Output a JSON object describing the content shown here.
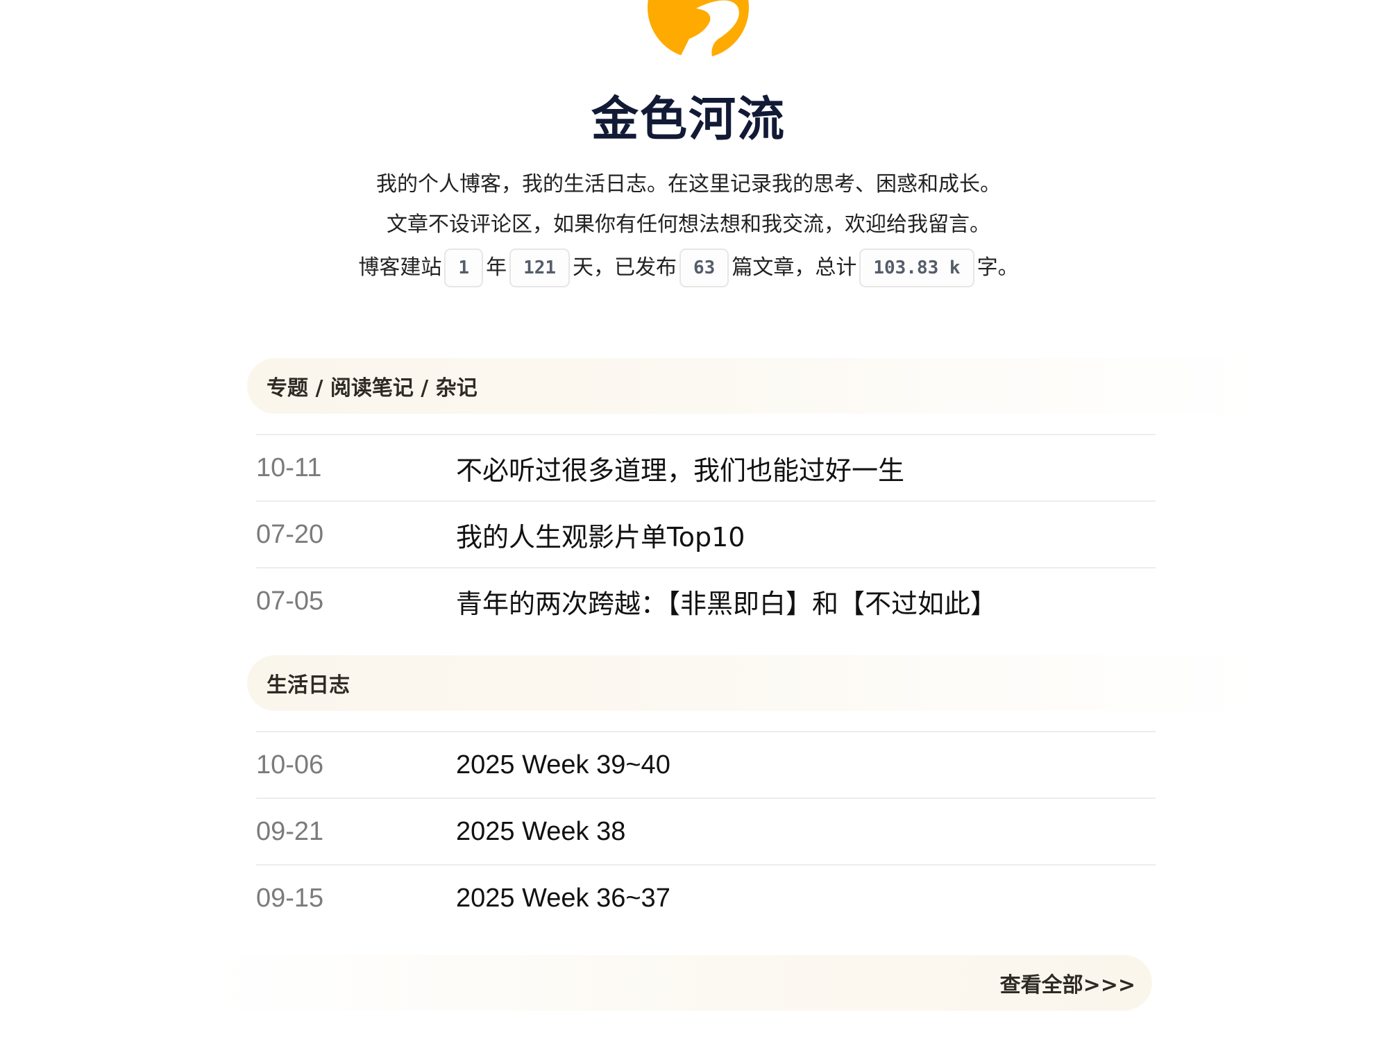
{
  "header": {
    "logo_icon": "golden-river-logo-icon",
    "logo_color": "#ffaa00",
    "site_title": "金色河流",
    "intro_line1": "我的个人博客，我的生活日志。在这里记录我的思考、困惑和成长。",
    "intro_line2": "文章不设评论区，如果你有任何想法想和我交流，欢迎给我留言。",
    "stats": {
      "prefix": "博客建站",
      "years": "1",
      "years_unit": "年",
      "days": "121",
      "days_unit": "天，已发布",
      "posts": "63",
      "posts_unit": "篇文章，总计",
      "words": "103.83 k",
      "words_unit": "字。"
    }
  },
  "sections": [
    {
      "title": "专题 / 阅读笔记 / 杂记",
      "posts": [
        {
          "date": "10-11",
          "title": "不必听过很多道理，我们也能过好一生"
        },
        {
          "date": "07-20",
          "title": "我的人生观影片单Top10"
        },
        {
          "date": "07-05",
          "title": "青年的两次跨越：【非黑即白】和【不过如此】"
        }
      ]
    },
    {
      "title": "生活日志",
      "posts": [
        {
          "date": "10-06",
          "title": "2025 Week 39~40"
        },
        {
          "date": "09-21",
          "title": "2025 Week 38"
        },
        {
          "date": "09-15",
          "title": "2025 Week 36~37"
        }
      ]
    }
  ],
  "view_all_label": "查看全部>>>",
  "colors": {
    "accent": "#ffaa00",
    "title": "#121a35",
    "date": "#7b7b7b",
    "section_bg": "#fbf6ec"
  }
}
